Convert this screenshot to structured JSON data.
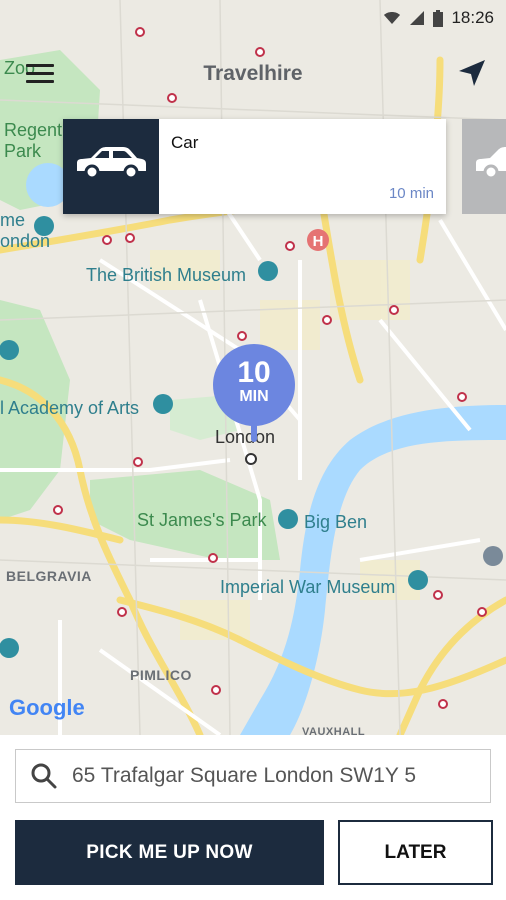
{
  "status_bar": {
    "time": "18:26"
  },
  "app": {
    "title": "Travelhire"
  },
  "vehicle_card": {
    "name": "Car",
    "eta": "10 min"
  },
  "eta_pin": {
    "value": "10",
    "unit": "MIN"
  },
  "map_labels": {
    "zoo": "Zoo",
    "regent_park_1": "Regent",
    "regent_park_2": "Park",
    "home_1": "me",
    "home_2": "ondon",
    "british_museum": "The British Museum",
    "academy": "l Academy of Arts",
    "london": "London",
    "st_james": "St James's Park",
    "big_ben": "Big Ben",
    "belgravia": "BELGRAVIA",
    "imperial_war": "Imperial War Museum",
    "pimlico": "PIMLICO",
    "vauxhall": "VAUXHALL"
  },
  "map_attribution": "Google",
  "search": {
    "value": "65 Trafalgar Square London SW1Y 5"
  },
  "buttons": {
    "now": "PICK ME UP NOW",
    "later": "LATER"
  },
  "colors": {
    "navy": "#1c2b3e",
    "eta_blue": "#6c86e0",
    "river": "#aadaff",
    "park": "#c5e6c0",
    "road": "#f6dd7b"
  }
}
